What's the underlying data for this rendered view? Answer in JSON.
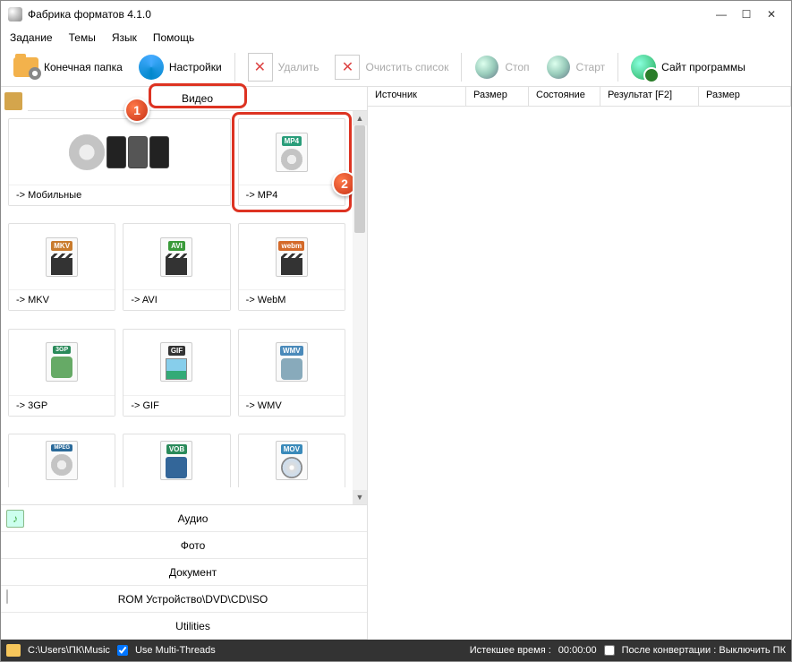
{
  "window": {
    "title": "Фабрика форматов 4.1.0"
  },
  "menu": {
    "task": "Задание",
    "themes": "Темы",
    "language": "Язык",
    "help": "Помощь"
  },
  "toolbar": {
    "output_folder": "Конечная папка",
    "settings": "Настройки",
    "delete": "Удалить",
    "clear_list": "Очистить список",
    "stop": "Стоп",
    "start": "Старт",
    "site": "Сайт программы"
  },
  "categories": {
    "video": "Видео",
    "audio": "Аудио",
    "photo": "Фото",
    "document": "Документ",
    "rom": "ROM Устройство\\DVD\\CD\\ISO",
    "utilities": "Utilities"
  },
  "tiles": {
    "mobile": "-> Мобильные",
    "mp4": "-> MP4",
    "mkv": "-> MKV",
    "avi": "-> AVI",
    "webm": "-> WebM",
    "3gp": "-> 3GP",
    "gif": "-> GIF",
    "wmv": "-> WMV",
    "mpeg": "",
    "vob": "",
    "mov": ""
  },
  "tile_icons": {
    "mp4": "MP4",
    "mkv": "MKV",
    "avi": "AVI",
    "webm": "webm",
    "3gp": "3GP",
    "gif": "GIF",
    "wmv": "WMV",
    "mpeg": "MPEG",
    "vob": "VOB",
    "mov": "MOV"
  },
  "listcols": {
    "source": "Источник",
    "size": "Размер",
    "state": "Состояние",
    "result": "Результат [F2]",
    "size2": "Размер"
  },
  "status": {
    "path": "C:\\Users\\ПК\\Music",
    "multithreads": "Use Multi-Threads",
    "elapsed_label": "Истекшее время :",
    "elapsed_value": "00:00:00",
    "after_conv": "После конвертации : Выключить ПК"
  },
  "markers": {
    "m1": "1",
    "m2": "2"
  }
}
